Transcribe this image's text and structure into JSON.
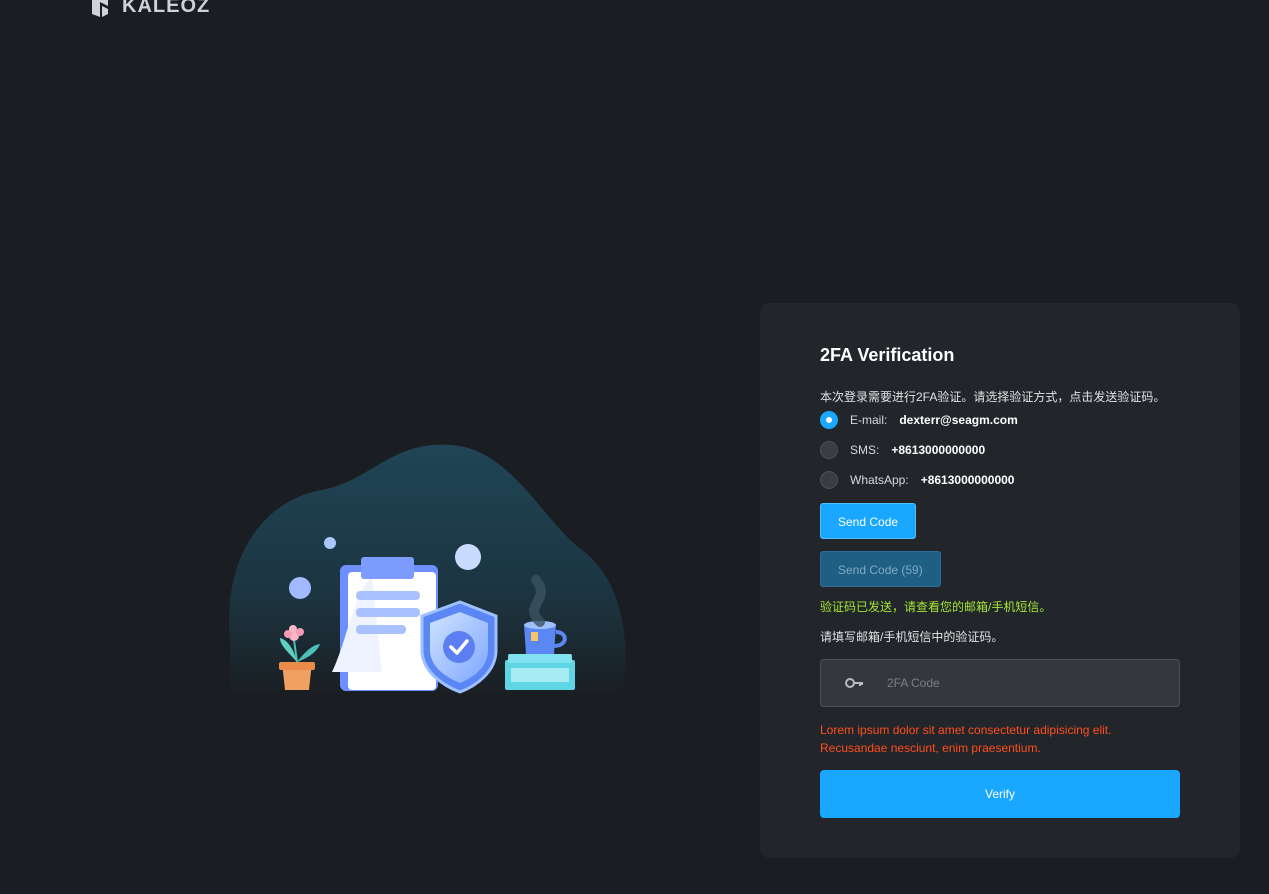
{
  "brand": {
    "name": "KALEOZ"
  },
  "card": {
    "title": "2FA Verification",
    "instructions": "本次登录需要进行2FA验证。请选择验证方式，点击发送验证码。",
    "methods": [
      {
        "label": "E-mail:",
        "value": "dexterr@seagm.com",
        "selected": true
      },
      {
        "label": "SMS:",
        "value": "+8613000000000",
        "selected": false
      },
      {
        "label": "WhatsApp:",
        "value": "+8613000000000",
        "selected": false
      }
    ],
    "send_code_label": "Send Code",
    "send_code_countdown_label": "Send Code (59)",
    "sent_message": "验证码已发送，请查看您的邮箱/手机短信。",
    "fill_hint": "请填写邮箱/手机短信中的验证码。",
    "code_input": {
      "placeholder": "2FA Code",
      "value": ""
    },
    "error_message": "Lorem ipsum dolor sit amet consectetur adipisicing elit. Recusandae nesciunt, enim praesentium.",
    "verify_label": "Verify"
  },
  "colors": {
    "background": "#1a1d21",
    "card": "#22262a",
    "accent": "#1aa7ff",
    "success": "#a3e635",
    "error": "#ff4d1f"
  },
  "icons": {
    "logo": "kaleoz-logo-icon",
    "key": "key-icon",
    "illustration": "security-illustration"
  }
}
